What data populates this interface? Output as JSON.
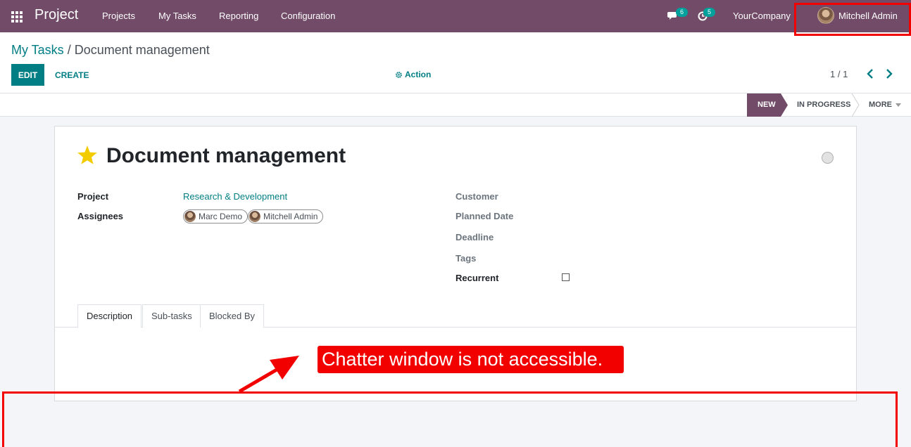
{
  "navbar": {
    "app_name": "Project",
    "menu": [
      "Projects",
      "My Tasks",
      "Reporting",
      "Configuration"
    ],
    "messages_count": "6",
    "activities_count": "5",
    "company": "YourCompany",
    "user": "Mitchell Admin"
  },
  "breadcrumb": {
    "parent": "My Tasks",
    "separator": " / ",
    "current": "Document management"
  },
  "buttons": {
    "edit": "EDIT",
    "create": "CREATE",
    "action": "Action"
  },
  "pager": {
    "value": "1 / 1"
  },
  "stages": {
    "new": "NEW",
    "in_progress": "IN PROGRESS",
    "more": "MORE"
  },
  "form": {
    "title": "Document management",
    "starred": true,
    "labels": {
      "project": "Project",
      "assignees": "Assignees",
      "customer": "Customer",
      "planned_date": "Planned Date",
      "deadline": "Deadline",
      "tags": "Tags",
      "recurrent": "Recurrent"
    },
    "project_value": "Research & Development",
    "assignees": [
      "Marc Demo",
      "Mitchell Admin"
    ],
    "recurrent_checked": false,
    "tabs": [
      "Description",
      "Sub-tasks",
      "Blocked By"
    ],
    "active_tab": "Description"
  },
  "annotation": {
    "callout_text": "Chatter window is not accessible.",
    "color": "#f20000"
  },
  "colors": {
    "brand": "#714b67",
    "accent": "#017e84",
    "badge": "#00a09d",
    "star": "#f3cc00"
  }
}
